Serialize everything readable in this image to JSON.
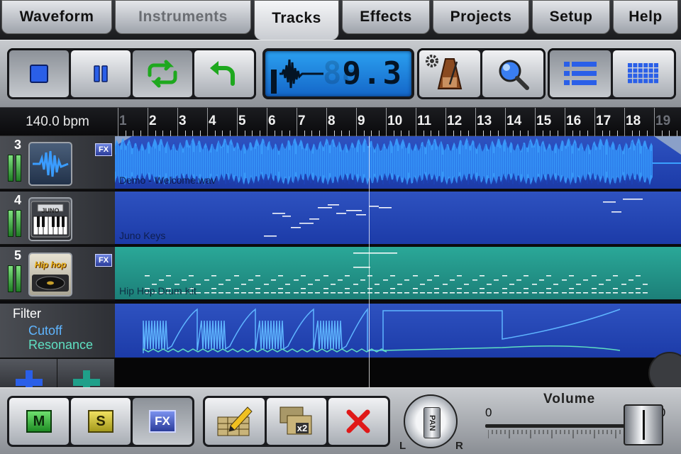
{
  "tabs": [
    {
      "label": "Waveform",
      "state": "normal"
    },
    {
      "label": "Instruments",
      "state": "disabled"
    },
    {
      "label": "Tracks",
      "state": "active"
    },
    {
      "label": "Effects",
      "state": "normal"
    },
    {
      "label": "Projects",
      "state": "normal"
    },
    {
      "label": "Setup",
      "state": "normal"
    },
    {
      "label": "Help",
      "state": "normal"
    }
  ],
  "toolbar": {
    "icons": [
      "stop-icon",
      "pause-icon",
      "loop-icon",
      "undo-icon",
      "settings-gear-icon",
      "metronome-icon",
      "zoom-icon",
      "list-view-icon",
      "grid-view-icon"
    ],
    "position_display": "9.3",
    "loop_active": true,
    "list_view_active": true
  },
  "ruler": {
    "tempo": "140.0 bpm",
    "bars": [
      "1",
      "2",
      "3",
      "4",
      "5",
      "6",
      "7",
      "8",
      "9",
      "10",
      "11",
      "12",
      "13",
      "14",
      "15",
      "16",
      "17",
      "18",
      "19"
    ],
    "loop_start_bar": 1,
    "loop_end_bar": 19
  },
  "tracks": [
    {
      "number": "3",
      "name": "Demo - Welcome.wav",
      "kind": "audio",
      "icon": "waveform-icon",
      "fx": "FX",
      "lane_color": "#1f45b4"
    },
    {
      "number": "4",
      "name": "Juno Keys",
      "kind": "instrument",
      "icon": "keyboard-synth-icon",
      "badge": "JUNO",
      "lane_color": "#1f45b4"
    },
    {
      "number": "5",
      "name": "Hip Hop Drum Kit",
      "kind": "drums",
      "icon": "turntable-icon",
      "badge": "Hip hop",
      "fx": "FX",
      "lane_color": "#1f8a80"
    }
  ],
  "automation": {
    "effect": "Filter",
    "param1": "Cutoff",
    "param2": "Resonance",
    "param1_color": "#5fb5ff",
    "param2_color": "#5fe0c2"
  },
  "add_buttons": [
    "add-track-icon",
    "add-automation-icon"
  ],
  "bottom": {
    "mute_label": "M",
    "solo_label": "S",
    "fx_label": "FX",
    "icons": [
      "edit-pencil-icon",
      "duplicate-x2-icon",
      "delete-x-icon"
    ],
    "duplicate_label": "x2",
    "pan_label": "PAN",
    "pan_left": "L",
    "pan_right": "R",
    "volume_title": "Volume",
    "volume_min": "0",
    "volume_max": "100",
    "volume_value": 90
  }
}
